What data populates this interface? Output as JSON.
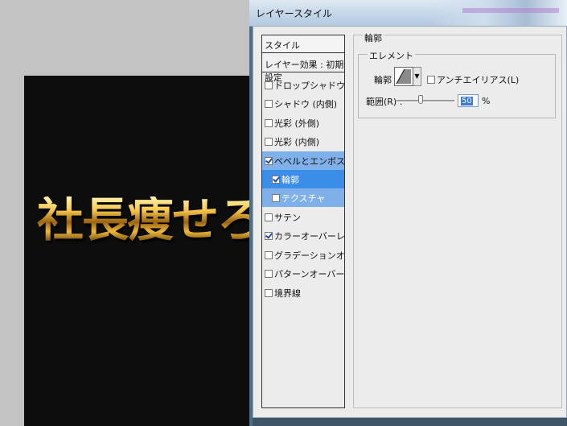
{
  "canvas": {
    "text": "社長痩せろ"
  },
  "dialog": {
    "title": "レイヤースタイル",
    "list_header": "スタイル",
    "list_effects": "レイヤー効果 : 初期設定",
    "items": [
      {
        "label": "ドロップシャドウ",
        "checked": false
      },
      {
        "label": "シャドウ (内側)",
        "checked": false
      },
      {
        "label": "光彩 (外側)",
        "checked": false
      },
      {
        "label": "光彩 (内側)",
        "checked": false
      },
      {
        "label": "ベベルとエンボス",
        "checked": true
      },
      {
        "label": "輪郭",
        "checked": true
      },
      {
        "label": "テクスチャ",
        "checked": false
      },
      {
        "label": "サテン",
        "checked": false
      },
      {
        "label": "カラーオーバーレイ",
        "checked": true
      },
      {
        "label": "グラデーションオーバーレイ",
        "checked": false
      },
      {
        "label": "パターンオーバーレイ",
        "checked": false
      },
      {
        "label": "境界線",
        "checked": false
      }
    ],
    "panel": {
      "title": "輪郭",
      "elements_label": "エレメント",
      "contour_label": "輪郭 :",
      "antialias_label": "アンチエイリアス(L)",
      "antialias_checked": false,
      "range_label": "範囲(R) :",
      "range_value": "50",
      "range_fraction": 0.5,
      "range_unit": "%"
    }
  }
}
